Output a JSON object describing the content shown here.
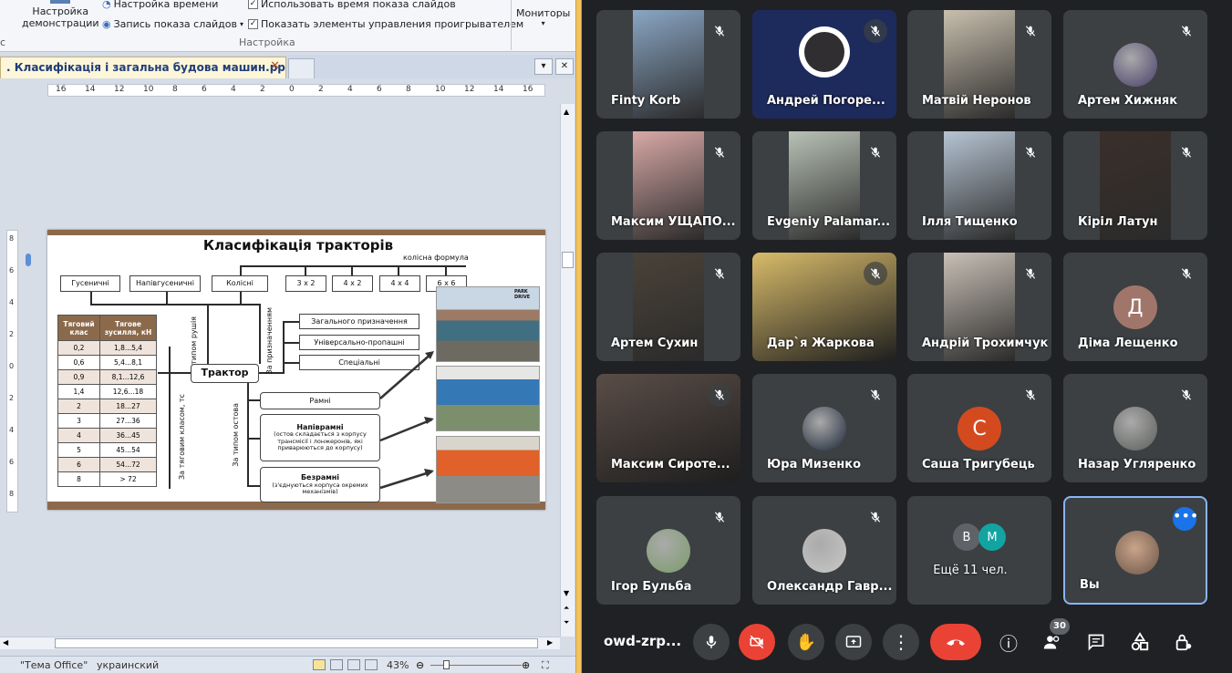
{
  "ppt": {
    "ribbon": {
      "btn_demo_line1": "Настройка",
      "btn_demo_line2": "демонстрации",
      "timing": "Настройка времени",
      "record": "Запись показа слайдов",
      "use_timing": "Использовать время показа слайдов",
      "show_controls": "Показать элементы управления проигрывателем",
      "group_label": "Настройка",
      "monitors": "Мониторы",
      "left_label": "с"
    },
    "tab_title": ". Класифікація і загальна будова машин.pptx",
    "ruler_h": [
      "16",
      "14",
      "12",
      "10",
      "8",
      "6",
      "4",
      "2",
      "0",
      "2",
      "4",
      "6",
      "8",
      "10",
      "12",
      "14",
      "16"
    ],
    "ruler_v": [
      "8",
      "6",
      "4",
      "2",
      "0",
      "2",
      "4",
      "6",
      "8"
    ],
    "status": {
      "theme": "\"Тема Office\"",
      "lang": "украинский",
      "zoom": "43%"
    },
    "slide": {
      "title": "Класифікація тракторів",
      "wheel_formula": "колісна формула",
      "types": [
        "Гусеничні",
        "Напівгусеничні",
        "Колісні"
      ],
      "formulas": [
        "3 х 2",
        "4 х 2",
        "4 х 4",
        "6 х 6"
      ],
      "tractor": "Трактор",
      "by_mover": "За типом рушія",
      "by_purpose": "За призначенням",
      "by_class": "За тяговим класом, тс",
      "by_frame": "За типом остова",
      "purposes": [
        "Загального призначення",
        "Універсально-пропашні",
        "Спеціальні"
      ],
      "frame_rama": "Рамні",
      "frame_semi_title": "Напіврамні",
      "frame_semi_desc": "(остов складається з корпусу трансмісії і лонжеронів, які приварюються до корпусу)",
      "frame_none_title": "Безрамні",
      "frame_none_desc": "(з'єднуються корпуса окремих механізмів)",
      "table_head": [
        "Тяговий клас",
        "Тягове зусилля, кН"
      ],
      "table_rows": [
        [
          "0,2",
          "1,8...5,4"
        ],
        [
          "0,6",
          "5,4...8,1"
        ],
        [
          "0,9",
          "8,1...12,6"
        ],
        [
          "1,4",
          "12,6...18"
        ],
        [
          "2",
          "18...27"
        ],
        [
          "3",
          "27...36"
        ],
        [
          "4",
          "36...45"
        ],
        [
          "5",
          "45...54"
        ],
        [
          "6",
          "54...72"
        ],
        [
          "8",
          "> 72"
        ]
      ],
      "park_logo": "PARK DRIVE"
    }
  },
  "meet": {
    "participants": [
      {
        "name": "Finty Korb",
        "kind": "video",
        "color": "#8aa6c4"
      },
      {
        "name": "Андрей Погоре...",
        "kind": "obs",
        "color": "#1d2a5c"
      },
      {
        "name": "Матвій Неронов",
        "kind": "video",
        "color": "#c8bfae"
      },
      {
        "name": "Артем Хижняк",
        "kind": "avatar-img",
        "color": "#4a3f6b"
      },
      {
        "name": "Максим УЩАПО...",
        "kind": "video",
        "color": "#d8a9a6"
      },
      {
        "name": "Evgeniy Palamar...",
        "kind": "video",
        "color": "#b9c2b6"
      },
      {
        "name": "Ілля Тищенко",
        "kind": "video",
        "color": "#b6c4d3"
      },
      {
        "name": "Кіріл Латун",
        "kind": "video",
        "color": "#3a2f2a"
      },
      {
        "name": "Артем Сухин",
        "kind": "video",
        "color": "#4a4238"
      },
      {
        "name": "Дар`я Жаркова",
        "kind": "video-wide",
        "color": "#d8bb6a"
      },
      {
        "name": "Андрій Трохимчук",
        "kind": "video",
        "color": "#c9c0b6"
      },
      {
        "name": "Діма Лещенко",
        "kind": "letter",
        "letter": "Д",
        "color": "#a1766a"
      },
      {
        "name": "Максим Сироте...",
        "kind": "video-wide",
        "color": "#5a4d47"
      },
      {
        "name": "Юра Мизенко",
        "kind": "avatar-img",
        "color": "#1c2638"
      },
      {
        "name": "Саша Тригубець",
        "kind": "letter",
        "letter": "С",
        "color": "#d44a1f"
      },
      {
        "name": "Назар Угляренко",
        "kind": "avatar-img",
        "color": "#5b5e5a"
      },
      {
        "name": "Ігор Бульба",
        "kind": "avatar-img",
        "color": "#7b9c6a"
      },
      {
        "name": "Олександр Гавр...",
        "kind": "avatar-img",
        "color": "#c8c8c8"
      },
      {
        "name": "Ещё 11 чел.",
        "kind": "more",
        "color": "#3c4043"
      },
      {
        "name": "Вы",
        "kind": "self",
        "color": "#6b5548"
      }
    ],
    "more_avatars": [
      "В",
      "М"
    ],
    "meeting_code": "owd-zrp...",
    "participant_count": "30"
  },
  "colors": {
    "meet_bg": "#202124",
    "tile_bg": "#3c4043",
    "end_call": "#ea4335",
    "cam_off": "#ea4335",
    "accent": "#8ab4f8",
    "slide_brown": "#8b6a4c"
  }
}
